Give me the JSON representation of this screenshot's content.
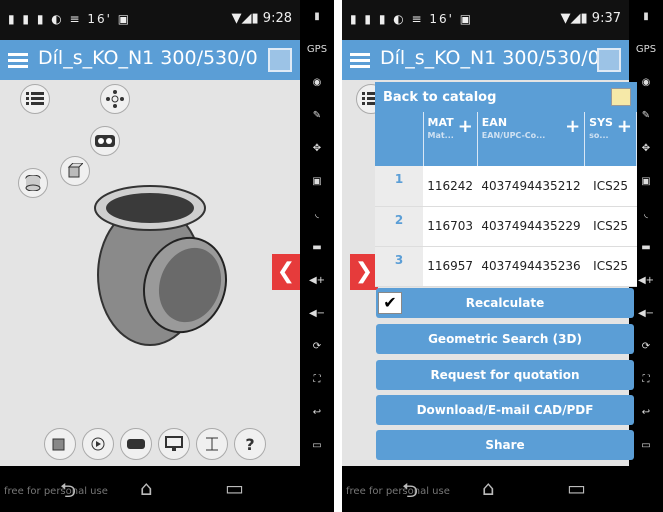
{
  "left": {
    "status_left": "▮ ▮ ▮ ◐ ≡ 16' ▣",
    "status_right": "▼◢▮ 9:28",
    "title": "Díl_s_KO_N1 300/530/0,...",
    "bottom_buttons": [
      "cube-icon",
      "rotate-play-icon",
      "vr-glasses-icon",
      "monitor-icon",
      "dimension-icon",
      "help-icon"
    ],
    "help_label": "?",
    "watermark": "free for personal use",
    "red_tab": "❮"
  },
  "right": {
    "status_left": "▮ ▮ ▮ ◐ ≡ 16' ▣",
    "status_right": "▼◢▮ 9:37",
    "title": "Díl_s_KO_N1 300/530/0,...",
    "back": "Back to catalog",
    "columns": [
      {
        "label": "MAT",
        "sub": "Mat..."
      },
      {
        "label": "EAN",
        "sub": "EAN/UPC-Co..."
      },
      {
        "label": "SYS",
        "sub": "so..."
      }
    ],
    "rows": [
      {
        "num": "1",
        "mat": "116242",
        "ean": "4037494435212",
        "sys": "ICS25"
      },
      {
        "num": "2",
        "mat": "116703",
        "ean": "4037494435229",
        "sys": "ICS25"
      },
      {
        "num": "3",
        "mat": "116957",
        "ean": "4037494435236",
        "sys": "ICS25"
      }
    ],
    "recalculate": "Recalculate",
    "actions": [
      "Geometric Search (3D)",
      "Request for quotation",
      "Download/E-mail CAD/PDF",
      "Share"
    ],
    "watermark": "free for personal use",
    "red_tab": "❯"
  },
  "sidebar": {
    "gps": "GPS"
  },
  "colors": {
    "accent": "#5b9ed6",
    "red": "#e63b3b",
    "canvas": "#e4e4e4"
  }
}
